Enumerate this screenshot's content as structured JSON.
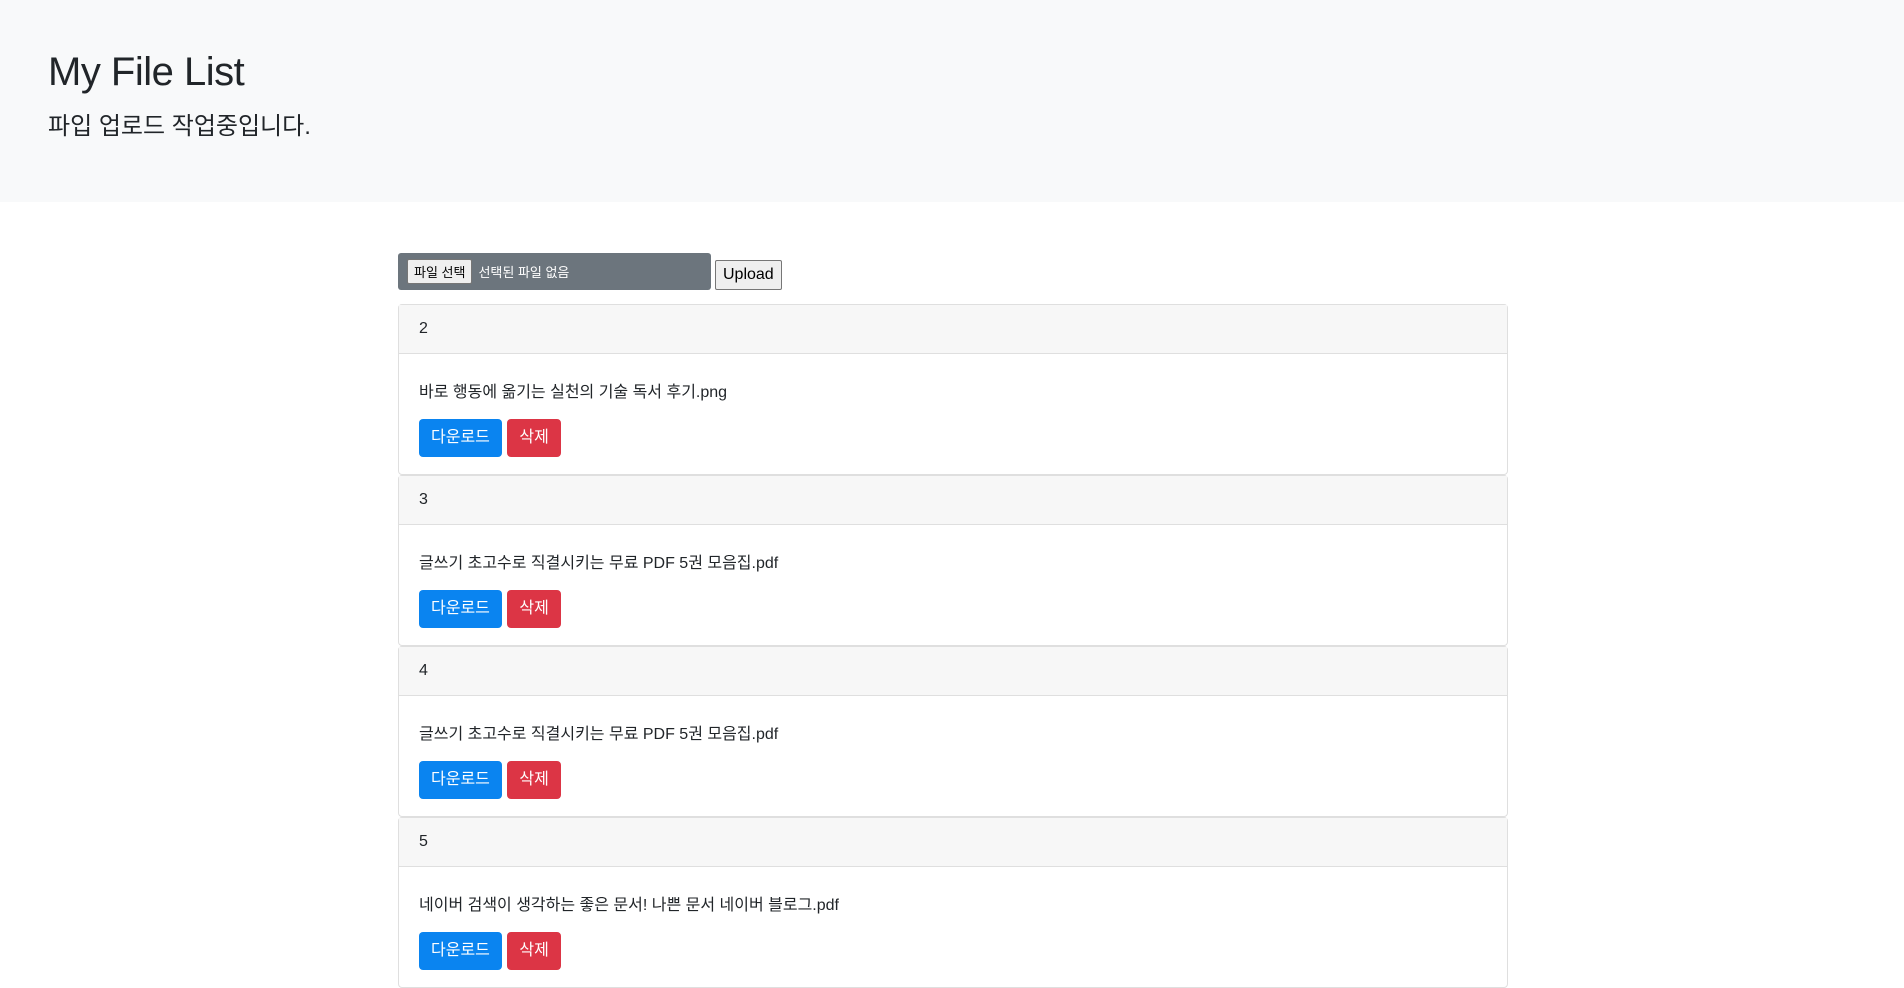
{
  "header": {
    "title": "My File List",
    "subtitle": "파입 업로드 작업중입니다."
  },
  "upload": {
    "choose_label": "파일 선택",
    "no_file_text": "선택된 파일 없음",
    "upload_label": "Upload"
  },
  "files": [
    {
      "id": "2",
      "name": "바로 행동에 옮기는 실천의 기술 독서 후기.png",
      "download_label": "다운로드",
      "delete_label": "삭제"
    },
    {
      "id": "3",
      "name": "글쓰기 초고수로 직결시키는 무료 PDF 5권 모음집.pdf",
      "download_label": "다운로드",
      "delete_label": "삭제"
    },
    {
      "id": "4",
      "name": "글쓰기 초고수로 직결시키는 무료 PDF 5권 모음집.pdf",
      "download_label": "다운로드",
      "delete_label": "삭제"
    },
    {
      "id": "5",
      "name": "네이버 검색이 생각하는 좋은 문서! 나쁜 문서 네이버 블로그.pdf",
      "download_label": "다운로드",
      "delete_label": "삭제"
    }
  ],
  "colors": {
    "primary": "#0a84f0",
    "danger": "#dc3545",
    "jumbotron_bg": "#f8f9fa",
    "file_input_bg": "#6c757d"
  }
}
